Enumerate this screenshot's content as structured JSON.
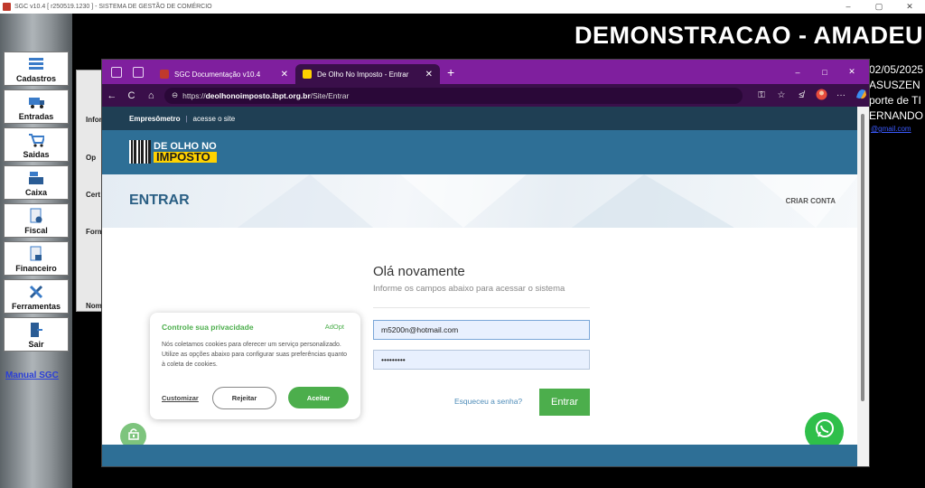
{
  "host": {
    "title": "SGC v10.4 [ r250519.1230 ] - SISTEMA DE GESTÃO DE COMÉRCIO",
    "ctrls": {
      "min": "–",
      "max": "▢",
      "close": "✕"
    }
  },
  "sidebar": {
    "items": [
      {
        "label": "Cadastros",
        "icon": "list-icon"
      },
      {
        "label": "Entradas",
        "icon": "truck-icon"
      },
      {
        "label": "Saidas",
        "icon": "cart-icon"
      },
      {
        "label": "Caixa",
        "icon": "register-icon"
      },
      {
        "label": "Fiscal",
        "icon": "fiscal-document-icon"
      },
      {
        "label": "Financeiro",
        "icon": "finance-document-icon"
      },
      {
        "label": "Ferramentas",
        "icon": "tools-icon"
      },
      {
        "label": "Sair",
        "icon": "exit-door-icon"
      }
    ],
    "manual_link": "Manual SGC"
  },
  "background_app": {
    "title": "DEMONSTRACAO - AMADEU",
    "info_lines": [
      "02/05/2025",
      "ASUSZEN",
      "porte de TI",
      "ERNANDO"
    ],
    "link": "@gmail.com",
    "panel_labels": [
      "Infor",
      "Op",
      "Cert",
      "Form",
      "Nome"
    ]
  },
  "browser": {
    "tabs": [
      {
        "label": "SGC Documentação v10.4",
        "close": "✕"
      },
      {
        "label": "De Olho No Imposto - Entrar",
        "close": "✕"
      }
    ],
    "new_tab": "+",
    "window_ctrls": {
      "min": "–",
      "max": "□",
      "close": "✕"
    },
    "nav": {
      "back": "←",
      "refresh": "C",
      "home": "⌂"
    },
    "url": {
      "prefix": "https://",
      "domain": "deolhonoimposto.ibpt.org.br",
      "path": "/Site/Entrar"
    },
    "toolbar_icons": [
      "key-icon",
      "star-icon",
      "favorites-icon",
      "profile-icon",
      "more-icon",
      "copilot-icon"
    ]
  },
  "page": {
    "ribbon": {
      "brand": "Empresômetro",
      "sep": "|",
      "link": "acesse o site"
    },
    "logo": {
      "line1": "DE OLHO NO",
      "line2": "IMPOSTO"
    },
    "hero": {
      "title": "ENTRAR",
      "create_account": "CRIAR CONTA"
    },
    "login": {
      "greeting": "Olá novamente",
      "subtitle": "Informe os campos abaixo para acessar o sistema",
      "email_value": "m5200n@hotmail.com",
      "password_value": "•••••••••",
      "forgot": "Esqueceu a senha?",
      "submit": "Entrar"
    },
    "cookie": {
      "title": "Controle sua privacidade",
      "brand": "AdOpt",
      "body": "Nós coletamos cookies para oferecer um serviço personalizado. Utilize as opções abaixo para configurar suas preferências quanto à coleta de cookies.",
      "customize": "Customizar",
      "reject": "Rejeitar",
      "accept": "Aceitar"
    }
  },
  "colors": {
    "accent_purple": "#7f1f9e",
    "header_blue": "#2e6f96",
    "green": "#4cae4c",
    "whatsapp": "#2fbf4a"
  }
}
